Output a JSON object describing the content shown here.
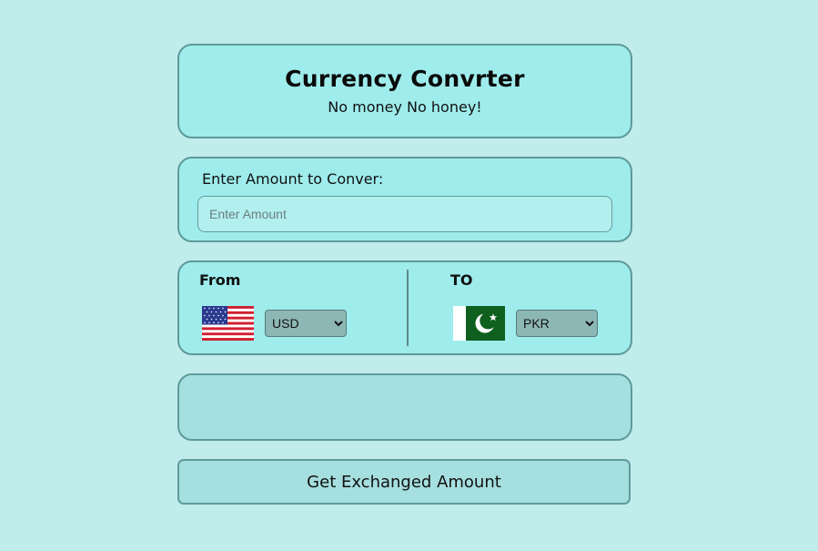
{
  "header": {
    "title": "Currency Convrter",
    "subtitle": "No money No honey!"
  },
  "amount": {
    "label": "Enter Amount to Conver:",
    "placeholder": "Enter Amount",
    "value": ""
  },
  "currency": {
    "from_label": "From",
    "to_label": "TO",
    "from_flag_icon": "us-flag-icon",
    "to_flag_icon": "pakistan-flag-icon",
    "from_selected": "USD",
    "to_selected": "PKR"
  },
  "result": {
    "text": ""
  },
  "actions": {
    "exchange_label": "Get Exchanged Amount"
  },
  "colors": {
    "background": "#c1ecec",
    "card": "#9fecec",
    "result_card": "#a6dfdf",
    "border": "#5e9a9a",
    "select": "#8db7b5"
  }
}
